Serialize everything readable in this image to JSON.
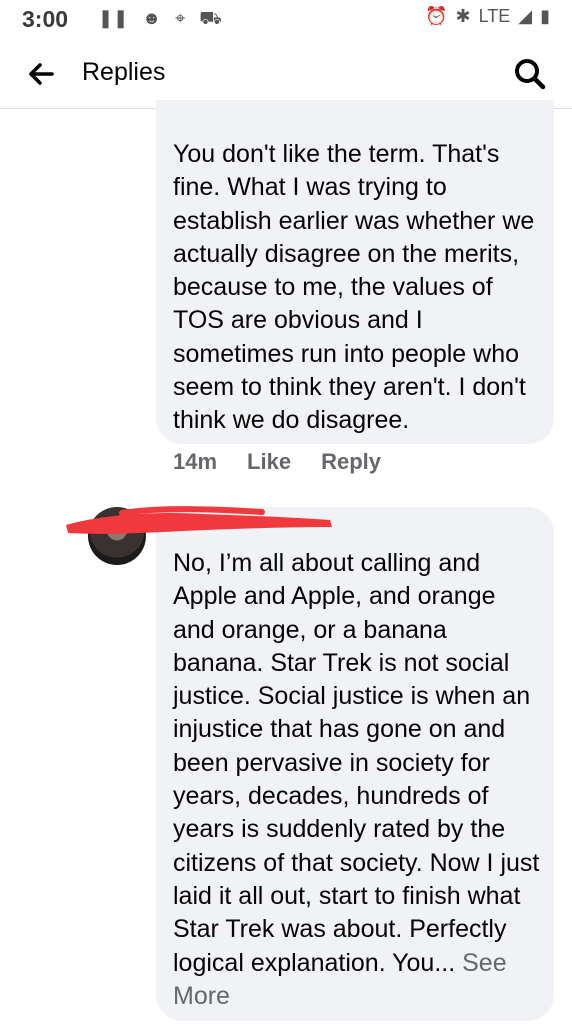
{
  "status_bar": {
    "time": "3:00",
    "network": "LTE"
  },
  "app_bar": {
    "title": "Replies"
  },
  "comment_1": {
    "text": "You don't like the term. That's fine. What I was trying to establish earlier was whether we actually disagree on the merits, because to me, the values of TOS are obvious and I sometimes run into people who seem to think they aren't. I don't think we do disagree.",
    "timestamp": "14m",
    "like_label": "Like",
    "reply_label": "Reply"
  },
  "comment_2": {
    "text": "No, I’m all about calling and Apple and Apple, and orange and orange, or a banana banana. Star Trek is not social justice. Social justice is when an injustice that has gone on and been pervasive in society for years, decades, hundreds of years is suddenly rated by the citizens of that society. Now I just laid it all out, start to finish what Star Trek was about. Perfectly logical explanation.  You...",
    "see_more": "See More"
  },
  "icons": {
    "back": "arrow-left-icon",
    "search": "search-icon"
  },
  "colors": {
    "bubble": "#f0f2f5",
    "meta": "#65676b",
    "redaction": "#f0393d"
  }
}
